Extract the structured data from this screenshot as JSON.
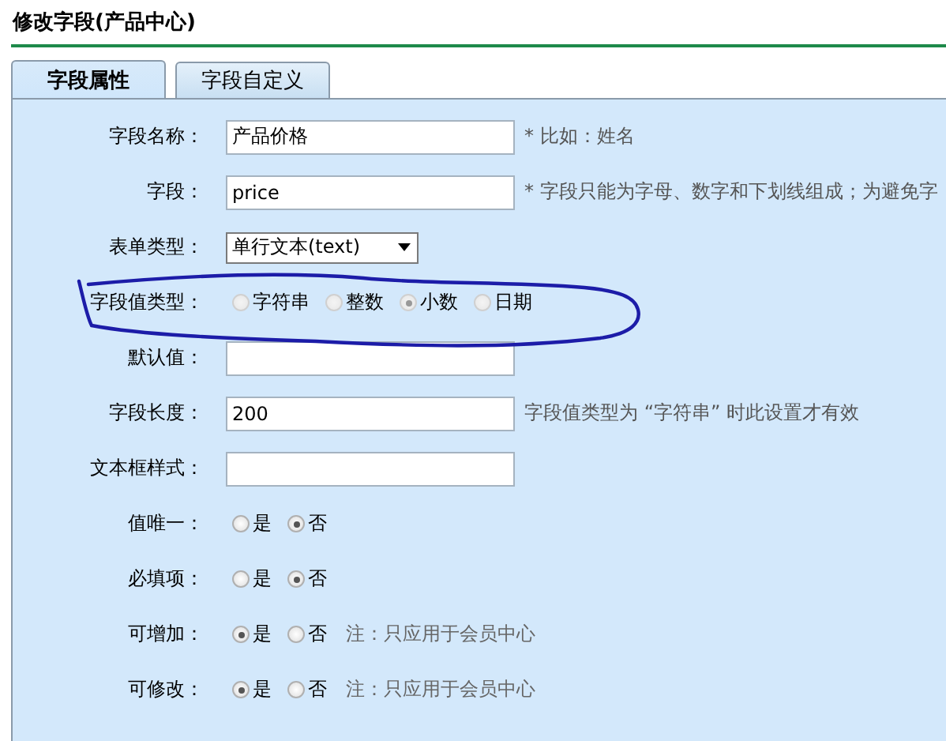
{
  "title": "修改字段(产品中心)",
  "tabs": [
    {
      "label": "字段属性",
      "selected": true
    },
    {
      "label": "字段自定义",
      "selected": false
    }
  ],
  "fields": [
    {
      "kind": "text",
      "label": "字段名称：",
      "value": "产品价格",
      "note": "* 比如：姓名"
    },
    {
      "kind": "text",
      "label": "字段：",
      "value": "price",
      "note": "* 字段只能为字母、数字和下划线组成；为避免字"
    },
    {
      "kind": "select",
      "label": "表单类型：",
      "value": "单行文本(text)"
    },
    {
      "kind": "radio",
      "label": "字段值类型：",
      "disabled": true,
      "options": [
        {
          "label": "字符串",
          "selected": false
        },
        {
          "label": "整数",
          "selected": false
        },
        {
          "label": "小数",
          "selected": true
        },
        {
          "label": "日期",
          "selected": false
        }
      ]
    },
    {
      "kind": "text",
      "label": "默认值："
    },
    {
      "kind": "text",
      "label": "字段长度：",
      "value": "200",
      "note": "字段值类型为 “字符串” 时此设置才有效"
    },
    {
      "kind": "text",
      "label": "文本框样式："
    },
    {
      "kind": "radio",
      "label": "值唯一：",
      "disabled": false,
      "options": [
        {
          "label": "是",
          "selected": false
        },
        {
          "label": "否",
          "selected": true
        }
      ]
    },
    {
      "kind": "radio",
      "label": "必填项：",
      "disabled": false,
      "options": [
        {
          "label": "是",
          "selected": false
        },
        {
          "label": "否",
          "selected": true
        }
      ]
    },
    {
      "kind": "radio",
      "label": "可增加：",
      "disabled": false,
      "options": [
        {
          "label": "是",
          "selected": true
        },
        {
          "label": "否",
          "selected": false
        }
      ],
      "note": "注：只应用于会员中心"
    },
    {
      "kind": "radio",
      "label": "可修改：",
      "disabled": false,
      "options": [
        {
          "label": "是",
          "selected": true
        },
        {
          "label": "否",
          "selected": false
        }
      ],
      "note": "注：只应用于会员中心"
    }
  ]
}
